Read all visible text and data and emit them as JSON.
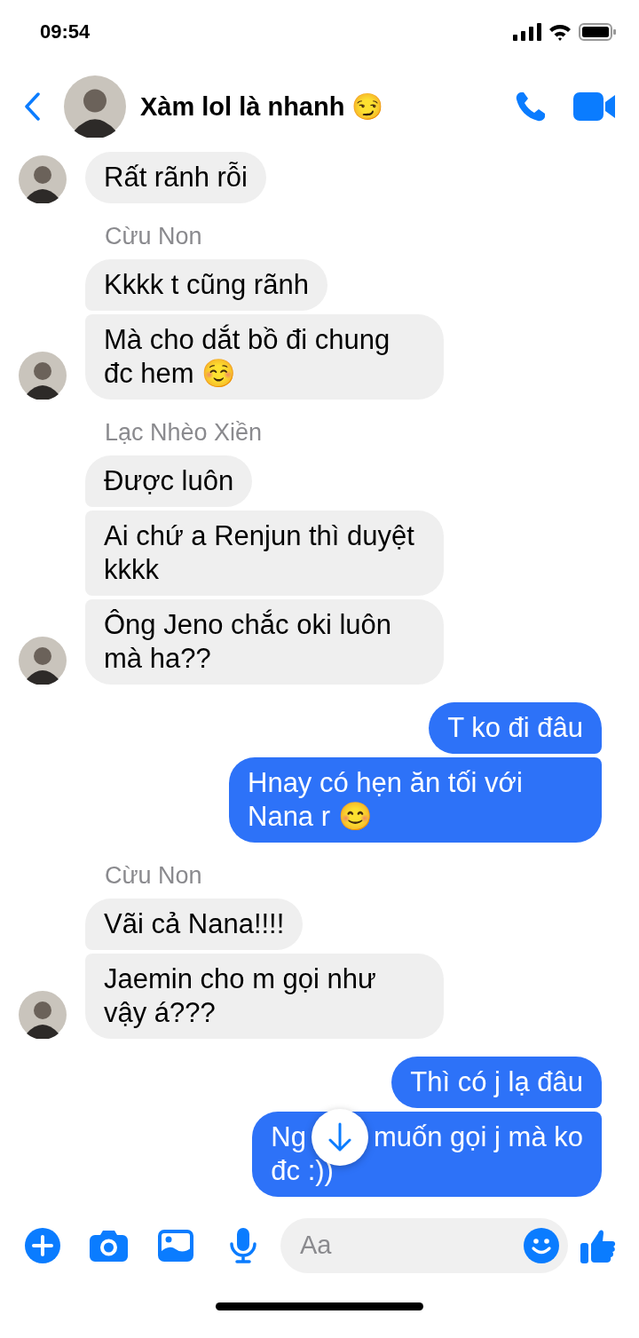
{
  "status_bar": {
    "time": "09:54"
  },
  "header": {
    "title": "Xàm lol là nhanh 😏"
  },
  "groups": [
    {
      "kind": "incoming",
      "bubbles": [
        {
          "text": "Rất rãnh rỗi"
        }
      ]
    },
    {
      "kind": "incoming",
      "sender": "Cừu Non",
      "bubbles": [
        {
          "text": "Kkkk t cũng rãnh"
        },
        {
          "text": "Mà cho dắt bồ đi chung đc hem ☺️"
        }
      ]
    },
    {
      "kind": "incoming",
      "sender": "Lạc Nhèo Xiền",
      "bubbles": [
        {
          "text": "Được luôn"
        },
        {
          "text": "Ai chứ a Renjun thì duyệt kkkk"
        },
        {
          "text": "Ông Jeno chắc oki luôn mà ha??"
        }
      ]
    },
    {
      "kind": "outgoing",
      "bubbles": [
        {
          "text": "T ko đi đâu"
        },
        {
          "text": "Hnay có hẹn ăn tối với Nana r 😊"
        }
      ]
    },
    {
      "kind": "incoming",
      "sender": "Cừu Non",
      "bubbles": [
        {
          "text": "Vãi cả Nana!!!!"
        },
        {
          "text": "Jaemin cho m gọi như vậy á???"
        }
      ]
    },
    {
      "kind": "outgoing",
      "bubbles": [
        {
          "text": "Thì có j lạ đâu"
        },
        {
          "parts": [
            "Ng",
            "muốn gọi j mà ko",
            "đc :))"
          ]
        }
      ]
    }
  ],
  "composer": {
    "placeholder": "Aa"
  }
}
